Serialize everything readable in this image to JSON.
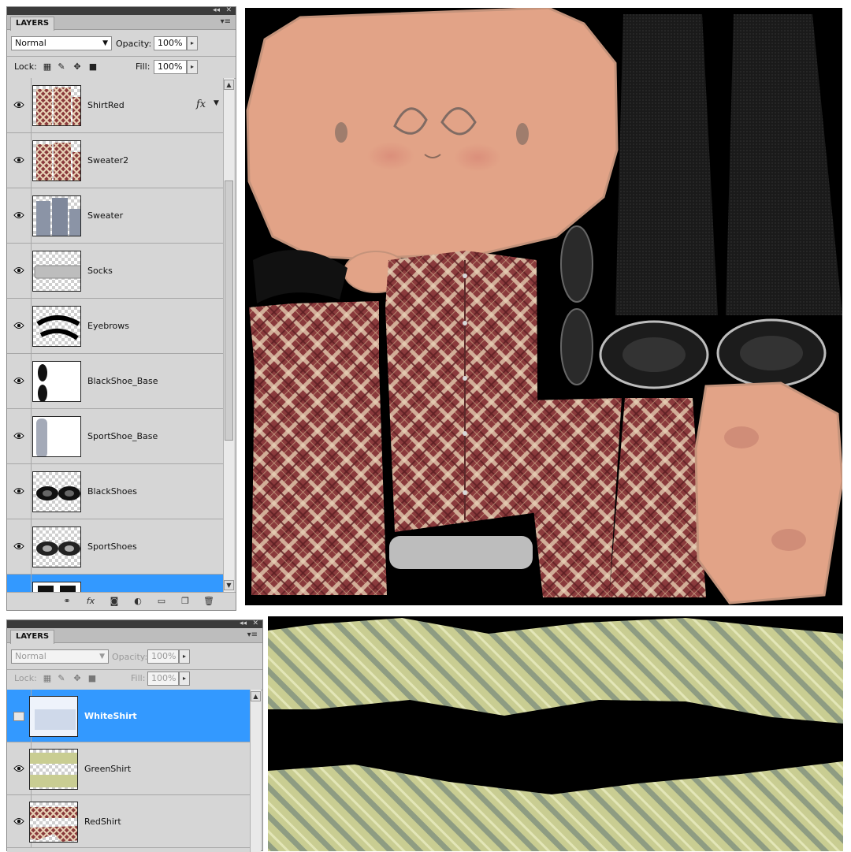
{
  "panel_top": {
    "tab_label": "LAYERS",
    "blend_mode": "Normal",
    "opacity_label": "Opacity:",
    "opacity_value": "100%",
    "lock_label": "Lock:",
    "fill_label": "Fill:",
    "fill_value": "100%",
    "layers": [
      {
        "name": "ShirtRed",
        "visible": true,
        "fx": true,
        "thumb": "plaid"
      },
      {
        "name": "Sweater2",
        "visible": true,
        "fx": false,
        "thumb": "plaid"
      },
      {
        "name": "Sweater",
        "visible": true,
        "fx": false,
        "thumb": "gray"
      },
      {
        "name": "Socks",
        "visible": true,
        "fx": false,
        "thumb": "socks"
      },
      {
        "name": "Eyebrows",
        "visible": true,
        "fx": false,
        "thumb": "brows"
      },
      {
        "name": "BlackShoe_Base",
        "visible": true,
        "fx": false,
        "thumb": "shoebase"
      },
      {
        "name": "SportShoe_Base",
        "visible": true,
        "fx": false,
        "thumb": "sportbase"
      },
      {
        "name": "BlackShoes",
        "visible": true,
        "fx": false,
        "thumb": "blackshoes"
      },
      {
        "name": "SportShoes",
        "visible": true,
        "fx": false,
        "thumb": "sportshoes"
      },
      {
        "name": "",
        "visible": false,
        "fx": false,
        "thumb": "pants",
        "selected": true
      }
    ],
    "fx_symbol": "fx"
  },
  "panel_bottom": {
    "tab_label": "LAYERS",
    "blend_mode": "Normal",
    "opacity_label": "Opacity:",
    "opacity_value": "100%",
    "lock_label": "Lock:",
    "fill_label": "Fill:",
    "fill_value": "100%",
    "layers": [
      {
        "name": "WhiteShirt",
        "visible": false,
        "thumb": "white",
        "selected": true
      },
      {
        "name": "GreenShirt",
        "visible": true,
        "thumb": "green"
      },
      {
        "name": "RedShirt",
        "visible": true,
        "thumb": "redshirt"
      }
    ]
  },
  "colors": {
    "panel_bg": "#d6d6d6",
    "selection": "#3399ff",
    "skin": "#e8a78a",
    "plaid_base": "#8a3a3c",
    "stripe_green": "#c9cd92",
    "canvas_bg": "#000000"
  },
  "icons": [
    "eye-icon",
    "link-icon",
    "fx-icon",
    "mask-icon",
    "adjustment-icon",
    "folder-icon",
    "new-layer-icon",
    "trash-icon",
    "panel-menu-icon",
    "collapse-icon",
    "close-icon"
  ]
}
